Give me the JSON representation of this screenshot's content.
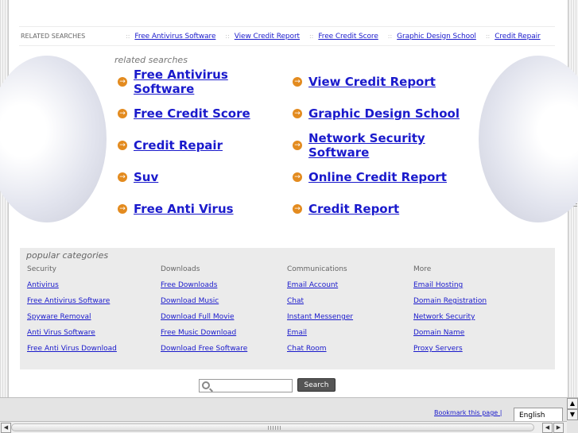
{
  "related_bar": {
    "label": "RELATED SEARCHES",
    "separator": "::",
    "links": [
      "Free Antivirus Software",
      "View Credit Report",
      "Free Credit Score",
      "Graphic Design School",
      "Credit Repair"
    ]
  },
  "related": {
    "title": "related searches",
    "arrow": "→",
    "links": [
      "Free Antivirus Software",
      "View Credit Report",
      "Free Credit Score",
      "Graphic Design School",
      "Credit Repair",
      "Network Security Software",
      "Suv",
      "Online Credit Report",
      "Free Anti Virus",
      "Credit Report"
    ]
  },
  "popular": {
    "title": "popular categories",
    "columns": [
      {
        "heading": "Security",
        "links": [
          "Antivirus",
          "Free Antivirus Software",
          "Spyware Removal",
          "Anti Virus Software",
          "Free Anti Virus Download"
        ]
      },
      {
        "heading": "Downloads",
        "links": [
          "Free Downloads",
          "Download Music",
          "Download Full Movie",
          "Free Music Download",
          "Download Free Software"
        ]
      },
      {
        "heading": "Communications",
        "links": [
          "Email Account",
          "Chat",
          "Instant Messenger",
          "Email",
          "Chat Room"
        ]
      },
      {
        "heading": "More",
        "links": [
          "Email Hosting",
          "Domain Registration",
          "Network Security",
          "Domain Name",
          "Proxy Servers"
        ]
      }
    ]
  },
  "search": {
    "value": "",
    "button_label": "Search"
  },
  "footer": {
    "bookmark_label": "Bookmark this page |",
    "language": "English"
  },
  "scrollbar": {
    "up": "▲",
    "down": "▼",
    "left": "◀",
    "right": "▶"
  },
  "colors": {
    "link": "#1a1acc",
    "arrow": "#e38b1f",
    "panel": "#ebebeb"
  }
}
